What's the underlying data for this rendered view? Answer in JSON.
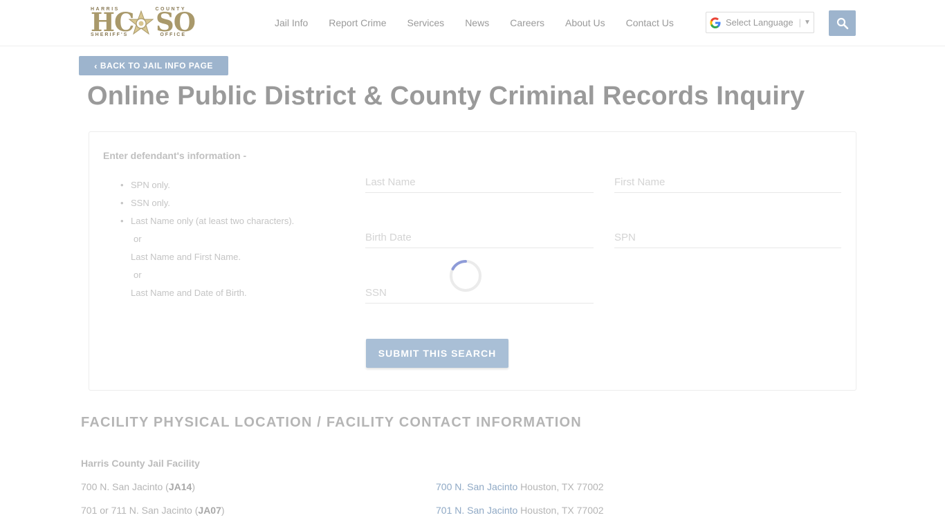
{
  "logo": {
    "top_left": "HARRIS",
    "top_right": "COUNTY",
    "letters_left": "HC",
    "letters_right": "SO",
    "bottom_left": "SHERIFF'S",
    "bottom_right": "OFFICE"
  },
  "nav": {
    "items": [
      "Jail Info",
      "Report Crime",
      "Services",
      "News",
      "Careers",
      "About Us",
      "Contact Us"
    ]
  },
  "language": {
    "label": "Select Language",
    "separator": "|",
    "arrow": "▼"
  },
  "back_button": {
    "chevron": "‹",
    "label": "BACK TO JAIL INFO PAGE"
  },
  "page_title": "Online Public District & County Criminal Records Inquiry",
  "form": {
    "intro": "Enter defendant's information -",
    "instructions": [
      "SPN only.",
      "SSN only.",
      "Last Name only (at least two characters).",
      "or",
      "Last Name and First Name.",
      "or",
      "Last Name and Date of Birth."
    ],
    "fields": {
      "last_name_placeholder": "Last Name",
      "first_name_placeholder": "First Name",
      "birth_date_placeholder": "Birth Date",
      "spn_placeholder": "SPN",
      "ssn_placeholder": "SSN"
    },
    "submit_label": "SUBMIT THIS SEARCH"
  },
  "facility": {
    "heading": "FACILITY PHYSICAL LOCATION / FACILITY CONTACT INFORMATION",
    "name": "Harris County Jail Facility",
    "rows": [
      {
        "prefix": "700 N. San Jacinto (",
        "code": "JA14",
        "suffix": ")",
        "link": "700 N. San Jacinto",
        "city": " Houston, TX 77002"
      },
      {
        "prefix": "701 or 711 N. San Jacinto (",
        "code": "JA07",
        "suffix": ")",
        "link": "701 N. San Jacinto",
        "city": " Houston, TX 77002"
      }
    ]
  },
  "colors": {
    "accent": "#9db4cd",
    "link": "#8fa9c5",
    "logo_gold": "#a9996b"
  }
}
